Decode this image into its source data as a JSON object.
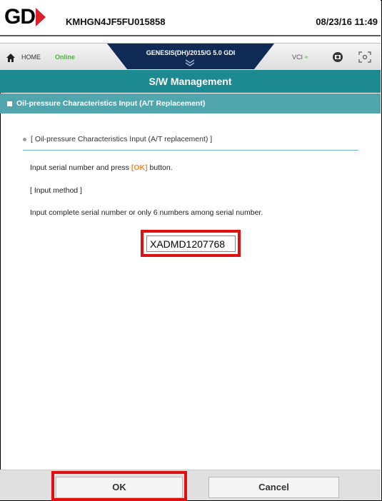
{
  "header": {
    "vin": "KMHGN4JF5FU015858",
    "datetime": "08/23/16 11:49"
  },
  "nav": {
    "home_label": "HOME",
    "status": "Online",
    "vehicle": "GENESIS(DH)/2015/G 5.0 GDI",
    "vci_label": "VCI"
  },
  "page": {
    "title": "S/W Management",
    "section_title": "Oil-pressure Characteristics Input (A/T Replacement)",
    "heading": "[ Oil-pressure Characteristics Input (A/T replacement) ]",
    "instruction_prefix": "Input serial number and press ",
    "instruction_ok": "[OK]",
    "instruction_suffix": " button.",
    "method_label": "[ Input method ]",
    "method_text": "Input complete serial number or only 6 numbers among serial number."
  },
  "serial_input": {
    "value": "XADMD1207768"
  },
  "buttons": {
    "ok": "OK",
    "cancel": "Cancel"
  },
  "colors": {
    "title_bar": "#1d8a91",
    "section_bar": "#51a6ad",
    "highlight_box": "#e01010",
    "ok_text": "#f28c28",
    "online": "#4caf3c",
    "vehicle_tab": "#0f2b55"
  }
}
